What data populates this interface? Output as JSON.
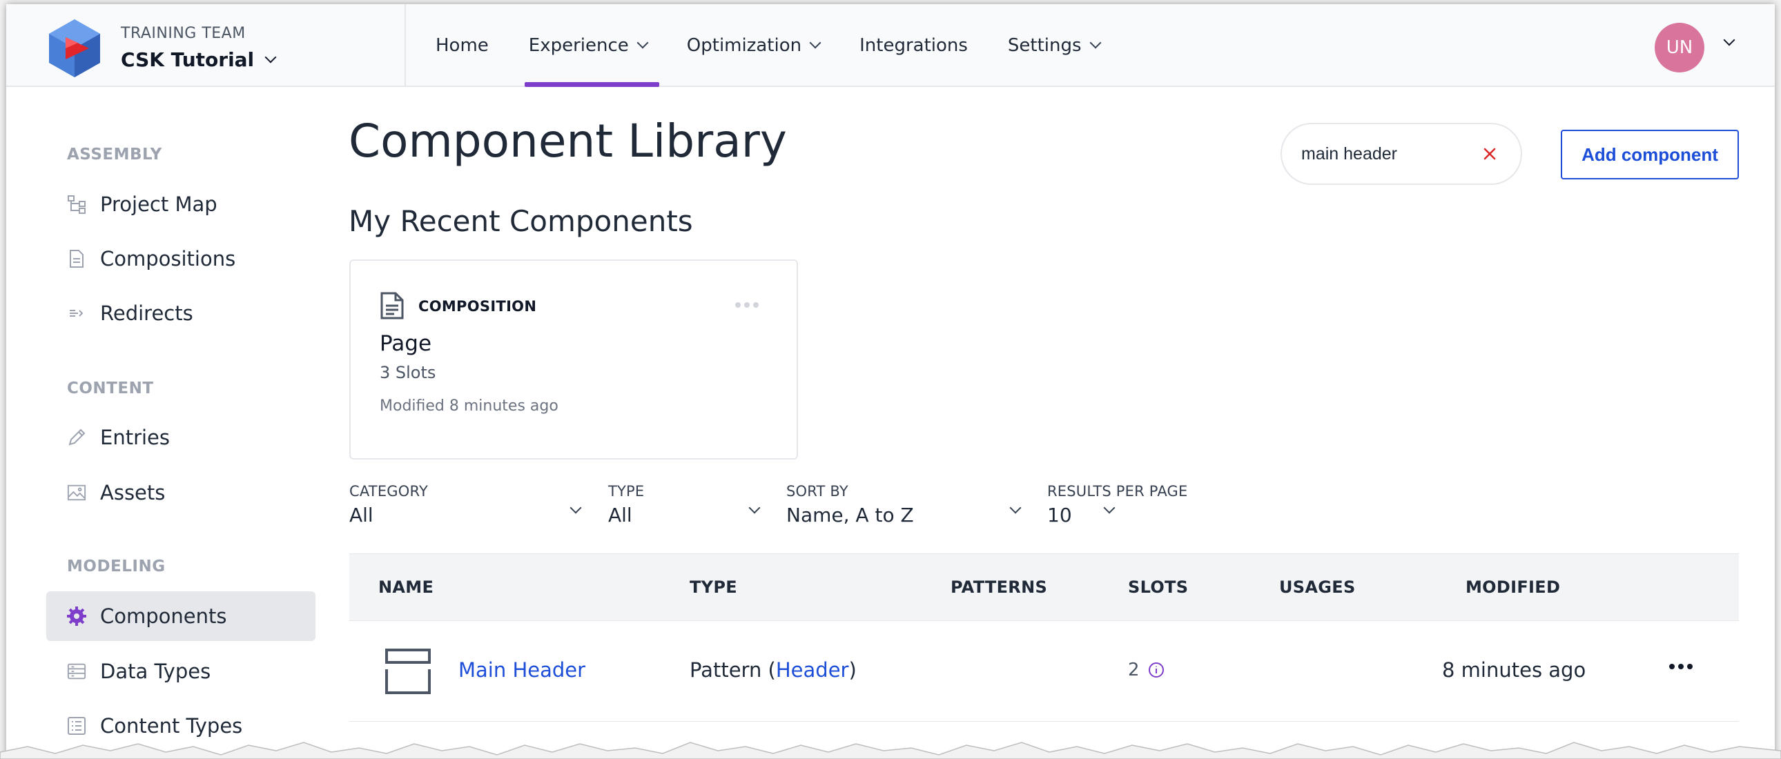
{
  "header": {
    "team_label": "TRAINING TEAM",
    "project_name": "CSK Tutorial",
    "nav": [
      {
        "label": "Home",
        "has_menu": false,
        "active": false
      },
      {
        "label": "Experience",
        "has_menu": true,
        "active": true
      },
      {
        "label": "Optimization",
        "has_menu": true,
        "active": false
      },
      {
        "label": "Integrations",
        "has_menu": false,
        "active": false
      },
      {
        "label": "Settings",
        "has_menu": true,
        "active": false
      }
    ],
    "avatar_initials": "UN",
    "accent_color": "#7e3ecb",
    "avatar_color": "#d9749c"
  },
  "sidebar": {
    "sections": [
      {
        "heading": "ASSEMBLY",
        "items": [
          {
            "label": "Project Map",
            "icon": "project-map-icon"
          },
          {
            "label": "Compositions",
            "icon": "document-icon"
          },
          {
            "label": "Redirects",
            "icon": "redirect-icon"
          }
        ]
      },
      {
        "heading": "CONTENT",
        "items": [
          {
            "label": "Entries",
            "icon": "pencil-icon"
          },
          {
            "label": "Assets",
            "icon": "image-icon"
          }
        ]
      },
      {
        "heading": "MODELING",
        "items": [
          {
            "label": "Components",
            "icon": "gear-icon",
            "active": true
          },
          {
            "label": "Data Types",
            "icon": "data-types-icon"
          },
          {
            "label": "Content Types",
            "icon": "list-icon"
          }
        ]
      }
    ]
  },
  "main": {
    "title": "Component Library",
    "search": {
      "value": "main header"
    },
    "add_button": "Add component",
    "recent_title": "My Recent Components",
    "recent_card": {
      "type": "COMPOSITION",
      "name": "Page",
      "slots": "3 Slots",
      "modified": "Modified 8 minutes ago"
    },
    "filters": [
      {
        "label": "CATEGORY",
        "value": "All"
      },
      {
        "label": "TYPE",
        "value": "All"
      },
      {
        "label": "SORT BY",
        "value": "Name, A to Z"
      },
      {
        "label": "RESULTS PER PAGE",
        "value": "10"
      }
    ],
    "table": {
      "columns": [
        "NAME",
        "TYPE",
        "PATTERNS",
        "SLOTS",
        "USAGES",
        "MODIFIED"
      ],
      "rows": [
        {
          "name": "Main Header",
          "type_prefix": "Pattern (",
          "type_link": "Header",
          "type_suffix": ")",
          "patterns": "",
          "slots": "2",
          "usages": "",
          "modified": "8 minutes ago"
        }
      ]
    }
  }
}
